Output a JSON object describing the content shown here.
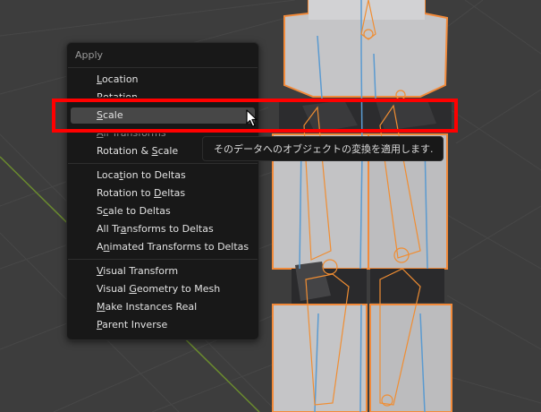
{
  "menu": {
    "title": "Apply",
    "items": [
      {
        "pre": "",
        "u": "L",
        "post": "ocation"
      },
      {
        "pre": "",
        "u": "R",
        "post": "otation"
      },
      {
        "pre": "",
        "u": "S",
        "post": "cale"
      },
      {
        "pre": "",
        "u": "A",
        "post": "ll Transforms"
      },
      {
        "pre": "Rotation & ",
        "u": "S",
        "post": "cale"
      },
      {
        "pre": "Loca",
        "u": "t",
        "post": "ion to Deltas"
      },
      {
        "pre": "Rotation to ",
        "u": "D",
        "post": "eltas"
      },
      {
        "pre": "S",
        "u": "c",
        "post": "ale to Deltas"
      },
      {
        "pre": "All Tr",
        "u": "a",
        "post": "nsforms to Deltas"
      },
      {
        "pre": "A",
        "u": "n",
        "post": "imated Transforms to Deltas"
      },
      {
        "pre": "",
        "u": "V",
        "post": "isual Transform"
      },
      {
        "pre": "Visual ",
        "u": "G",
        "post": "eometry to Mesh"
      },
      {
        "pre": "",
        "u": "M",
        "post": "ake Instances Real"
      },
      {
        "pre": "",
        "u": "P",
        "post": "arent Inverse"
      }
    ]
  },
  "tooltip": {
    "text": "そのデータへのオブジェクトの変換を適用します."
  },
  "colors": {
    "highlight_box": "#ff0000",
    "outline": "#f28a3a",
    "menu_bg": "#181818"
  }
}
